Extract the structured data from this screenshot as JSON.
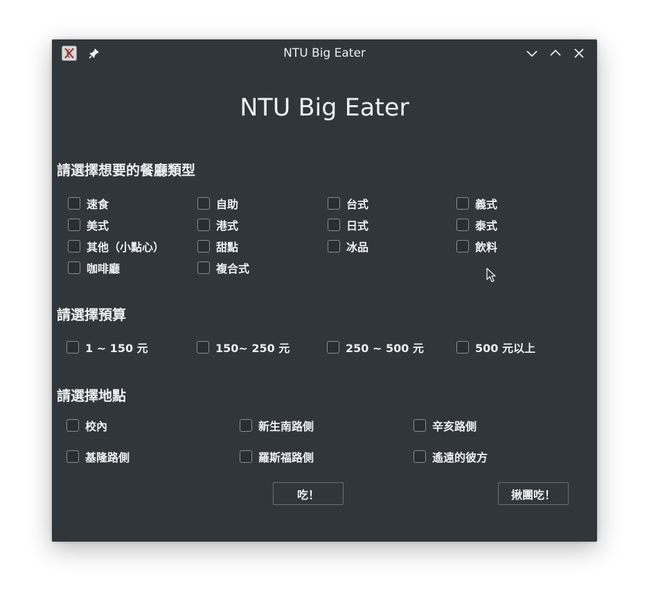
{
  "window": {
    "title": "NTU Big Eater"
  },
  "app": {
    "heading": "NTU Big Eater"
  },
  "cuisine": {
    "title": "請選擇想要的餐廳類型",
    "options": [
      "速食",
      "自助",
      "台式",
      "義式",
      "美式",
      "港式",
      "日式",
      "泰式",
      "其他（小點心）",
      "甜點",
      "冰品",
      "飲料",
      "咖啡廳",
      "複合式"
    ]
  },
  "budget": {
    "title": "請選擇預算",
    "options": [
      "1 ~ 150 元",
      "150~ 250 元",
      "250 ~ 500 元",
      "500 元以上"
    ]
  },
  "location": {
    "title": "請選擇地點",
    "options": [
      "校內",
      "新生南路側",
      "辛亥路側",
      "基隆路側",
      "羅斯福路側",
      "遙遠的彼方"
    ]
  },
  "actions": {
    "eat_label": "吃！",
    "group_eat_label": "揪團吃！"
  },
  "icons": {
    "app": "app-logo-icon",
    "pin": "pin-icon",
    "minimize": "chevron-down-icon",
    "maximize": "chevron-up-icon",
    "close": "close-icon"
  },
  "colors": {
    "window_bg": "#31363b",
    "text": "#eff0f1",
    "checkbox_border": "#8b8f93"
  }
}
